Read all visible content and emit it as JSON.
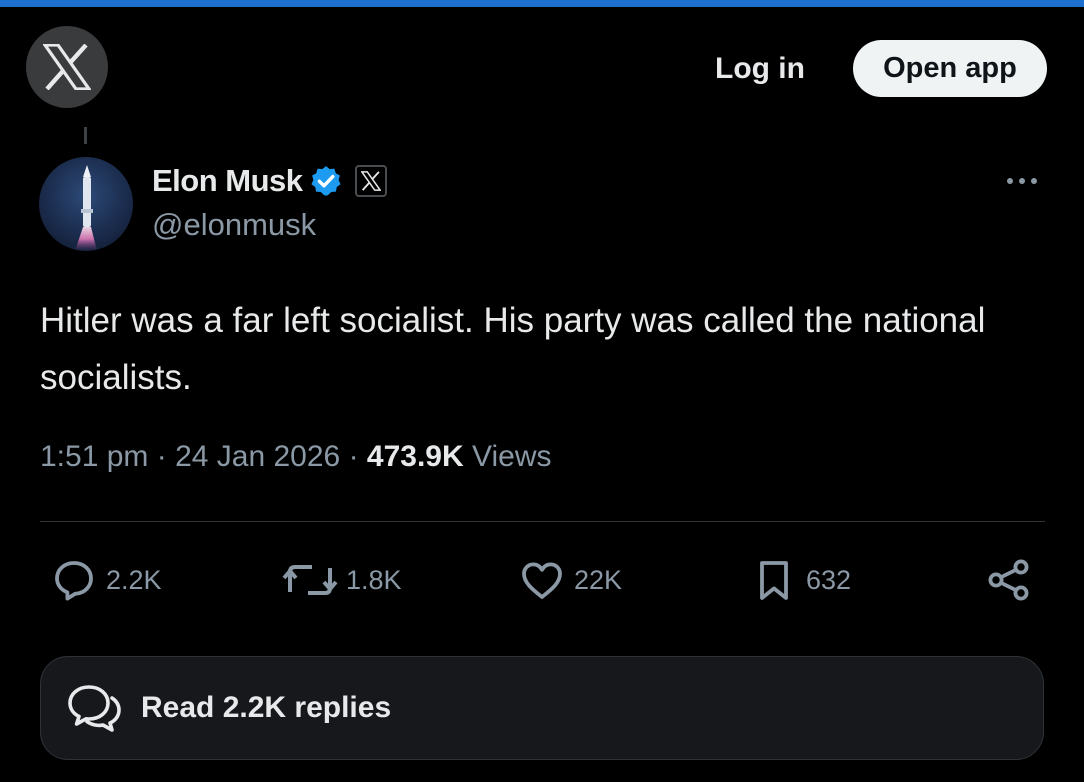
{
  "header": {
    "logo_icon": "x-logo-icon",
    "login_label": "Log in",
    "open_app_label": "Open app"
  },
  "author": {
    "name": "Elon Musk",
    "handle": "@elonmusk",
    "verified_color": "#1d9bf0",
    "affiliation_icon": "x-badge-icon"
  },
  "tweet": {
    "text": "Hitler was a far left socialist. His party was called the national socialists.",
    "time": "1:51 pm",
    "date": "24 Jan 2026",
    "views_count": "473.9K",
    "views_label": "Views"
  },
  "actions": {
    "replies": "2.2K",
    "reposts": "1.8K",
    "likes": "22K",
    "bookmarks": "632"
  },
  "footer": {
    "read_replies_label": "Read 2.2K replies"
  },
  "colors": {
    "accent_bar": "#1d6fd0",
    "background": "#000000",
    "muted_text": "#8b98a5"
  }
}
